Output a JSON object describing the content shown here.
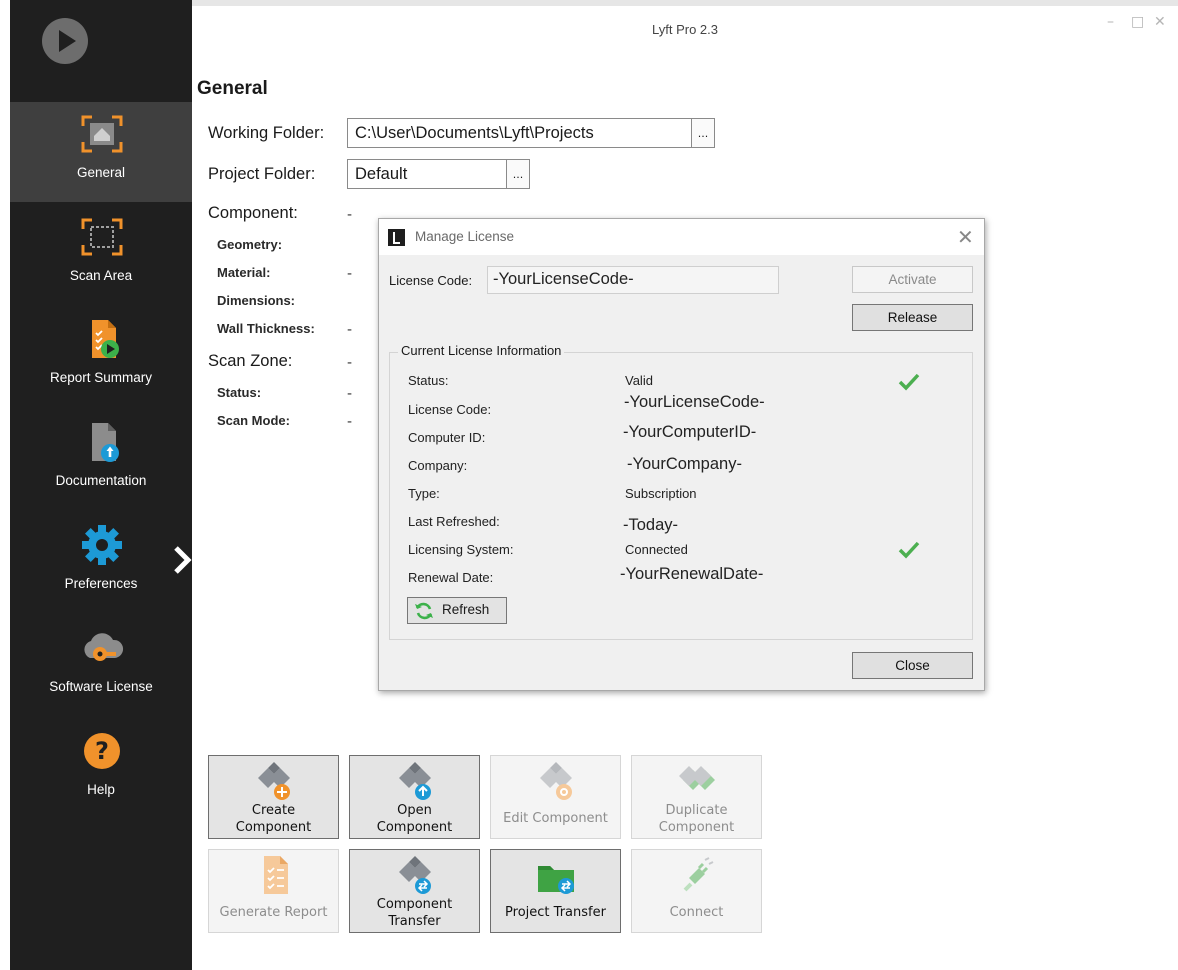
{
  "window": {
    "title": "Lyft Pro 2.3",
    "controls": [
      "–",
      "□",
      "✕"
    ]
  },
  "sidebar": {
    "items": [
      {
        "label": "General",
        "icon": "home-frame-icon",
        "active": true
      },
      {
        "label": "Scan Area",
        "icon": "scan-frame-icon",
        "active": false
      },
      {
        "label": "Report Summary",
        "icon": "report-play-icon",
        "active": false
      },
      {
        "label": "Documentation",
        "icon": "document-info-icon",
        "active": false
      },
      {
        "label": "Preferences",
        "icon": "gear-icon",
        "active": false
      },
      {
        "label": "Software License",
        "icon": "cloud-key-icon",
        "active": false
      },
      {
        "label": "Help",
        "icon": "help-icon",
        "active": false
      }
    ]
  },
  "general": {
    "heading": "General",
    "working_folder_label": "Working Folder:",
    "working_folder_value": "C:\\User\\Documents\\Lyft\\Projects",
    "project_folder_label": "Project Folder:",
    "project_folder_value": "Default",
    "browse_label": "...",
    "component_label": "Component:",
    "component_value": "-",
    "geometry_label": "Geometry:",
    "material_label": "Material:",
    "material_value": "-",
    "dimensions_label": "Dimensions:",
    "wall_thickness_label": "Wall Thickness:",
    "wall_thickness_value": "-",
    "scan_zone_label": "Scan Zone:",
    "scan_zone_value": "-",
    "status_label": "Status:",
    "status_value": "-",
    "scan_mode_label": "Scan Mode:",
    "scan_mode_value": "-"
  },
  "dialog": {
    "title": "Manage License",
    "license_code_label": "License Code:",
    "license_code_value": "-YourLicenseCode-",
    "activate_label": "Activate",
    "release_label": "Release",
    "group_title": "Current License Information",
    "rows": [
      {
        "label": "Status:",
        "value": "Valid"
      },
      {
        "label": "License Code:",
        "value": "-YourLicenseCode-"
      },
      {
        "label": "Computer ID:",
        "value": "-YourComputerID-"
      },
      {
        "label": "Company:",
        "value": "-YourCompany-"
      },
      {
        "label": "Type:",
        "value": "Subscription"
      },
      {
        "label": "Last Refreshed:",
        "value": "-Today-"
      },
      {
        "label": "Licensing System:",
        "value": "Connected"
      },
      {
        "label": "Renewal Date:",
        "value": "-YourRenewalDate-"
      }
    ],
    "refresh_label": "Refresh",
    "close_label": "Close"
  },
  "actions": [
    {
      "label": "Create\nComponent",
      "enabled": true,
      "icon": "create-component-icon"
    },
    {
      "label": "Open\nComponent",
      "enabled": true,
      "icon": "open-component-icon"
    },
    {
      "label": "Edit Component",
      "enabled": false,
      "icon": "edit-component-icon"
    },
    {
      "label": "Duplicate\nComponent",
      "enabled": false,
      "icon": "duplicate-component-icon"
    },
    {
      "label": "Generate Report",
      "enabled": false,
      "icon": "generate-report-icon"
    },
    {
      "label": "Component\nTransfer",
      "enabled": true,
      "icon": "component-transfer-icon"
    },
    {
      "label": "Project Transfer",
      "enabled": true,
      "icon": "project-transfer-icon"
    },
    {
      "label": "Connect",
      "enabled": false,
      "icon": "connect-plug-icon"
    }
  ],
  "colors": {
    "sidebar_bg": "#1f1f1f",
    "sidebar_active": "#3f3f3f",
    "accent_orange": "#f0922b",
    "accent_blue": "#1d9ad6",
    "check_green": "#4caf50"
  }
}
